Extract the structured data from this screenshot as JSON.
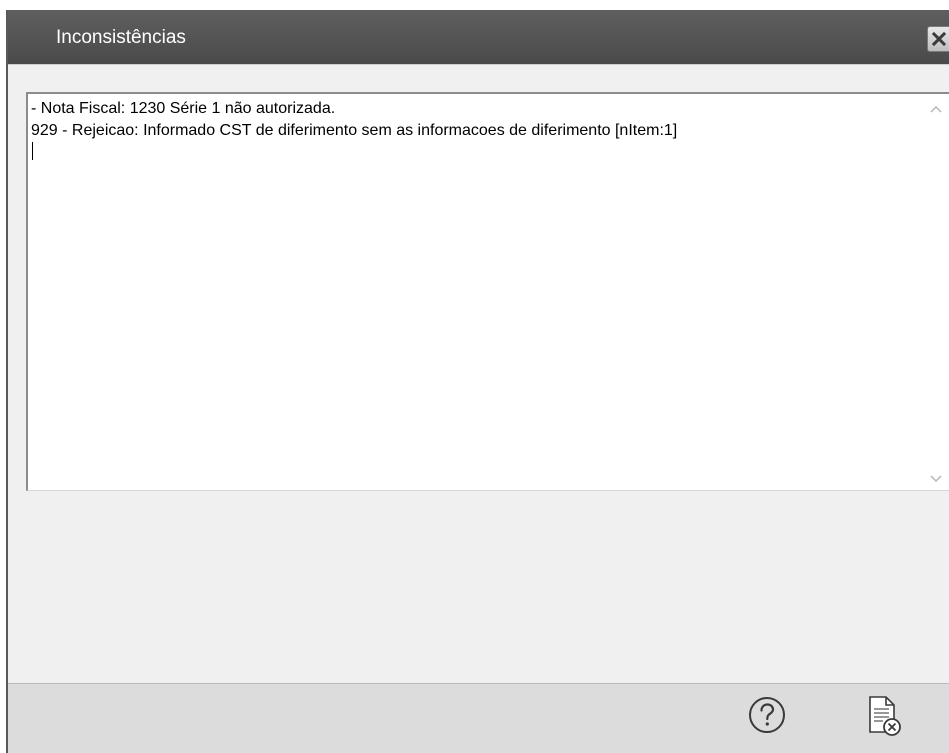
{
  "window": {
    "title": "Inconsistências"
  },
  "message": {
    "line1": "- Nota Fiscal: 1230 Série 1 não autorizada.",
    "line2": "929 - Rejeicao: Informado CST de diferimento sem as informacoes de diferimento [nItem:1]"
  },
  "icons": {
    "close": "close-icon",
    "help": "help-icon",
    "close_document": "document-close-icon",
    "scroll_up": "chevron-up-icon",
    "scroll_down": "chevron-down-icon"
  }
}
